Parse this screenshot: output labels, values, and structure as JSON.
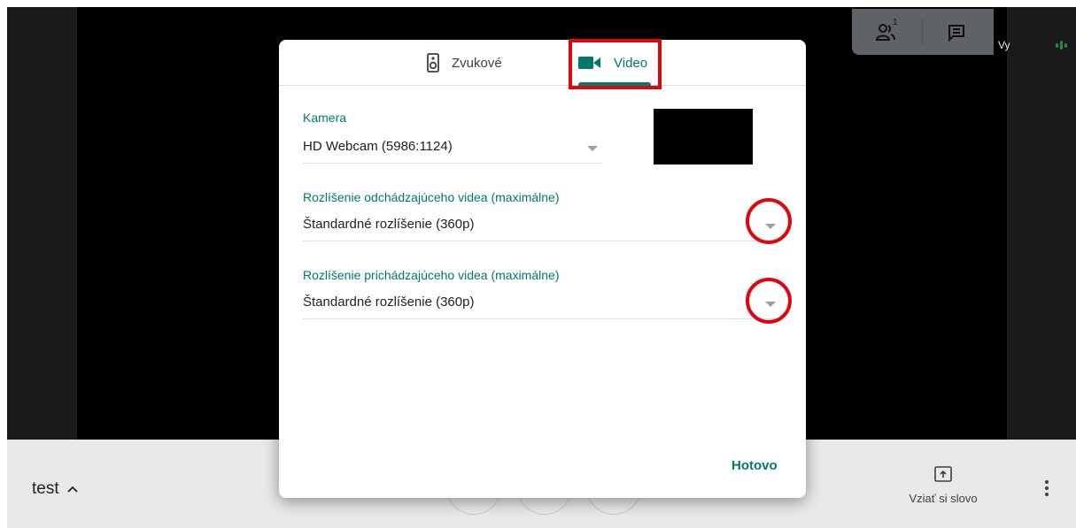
{
  "meeting": {
    "name": "test",
    "self_label": "Vy",
    "participants_count": "1"
  },
  "bottom_bar": {
    "present_label": "Vziať si slovo"
  },
  "dialog": {
    "tabs": [
      {
        "label": "Zvukové",
        "icon": "speaker-icon"
      },
      {
        "label": "Video",
        "icon": "videocam-icon"
      }
    ],
    "active_tab": "Video",
    "camera": {
      "label": "Kamera",
      "value": "HD Webcam (5986:1124)"
    },
    "outgoing": {
      "label": "Rozlíšenie odchádzajúceho videa (maximálne)",
      "value": "Štandardné rozlíšenie (360p)"
    },
    "incoming": {
      "label": "Rozlíšenie prichádzajúceho videa (maximálne)",
      "value": "Štandardné rozlíšenie (360p)"
    },
    "done_label": "Hotovo"
  },
  "colors": {
    "accent": "#00796b",
    "highlight": "#e1060d",
    "panel": "#5f6368"
  }
}
